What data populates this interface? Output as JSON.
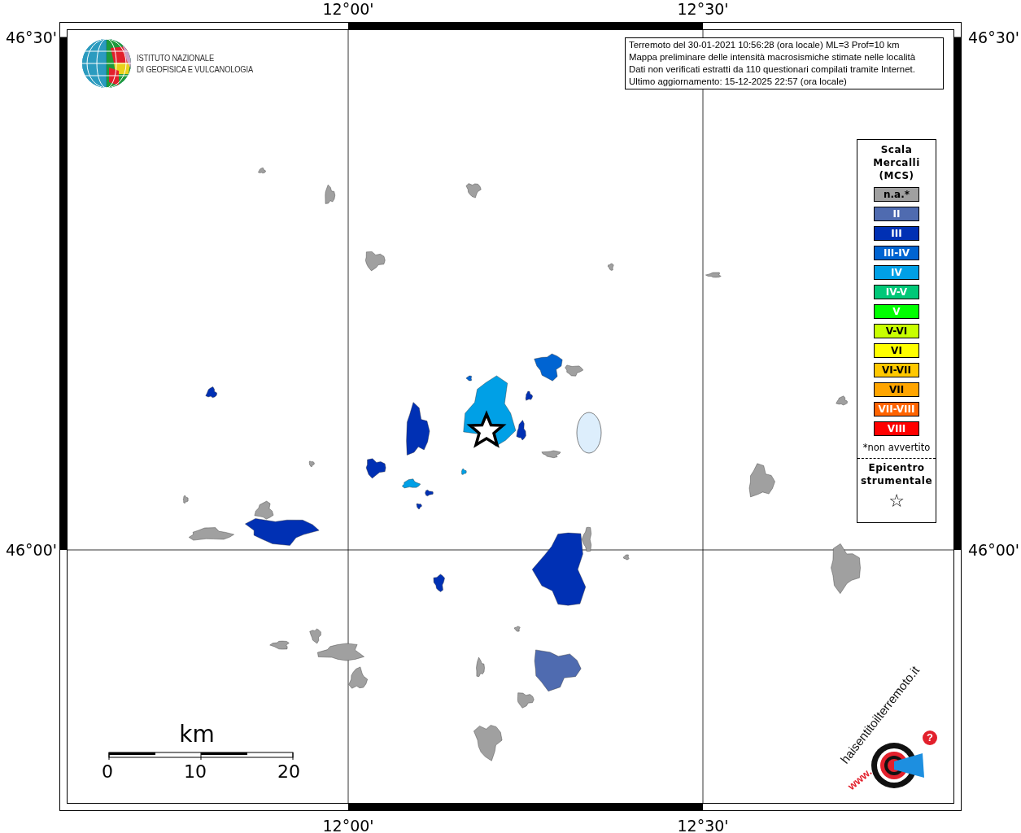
{
  "map": {
    "axis_labels": {
      "top": [
        "12°00'",
        "12°30'"
      ],
      "bottom": [
        "12°00'",
        "12°30'"
      ],
      "left": [
        "46°30'",
        "46°00'"
      ],
      "right": [
        "46°30'",
        "46°00'"
      ]
    },
    "areas": [
      {
        "color": "#a0a0a0"
      },
      {
        "color": "#a0a0a0"
      },
      {
        "color": "#a0a0a0"
      },
      {
        "color": "#a0a0a0"
      },
      {
        "color": "#a0a0a0"
      },
      {
        "color": "#a0a0a0"
      },
      {
        "color": "#a0a0a0"
      },
      {
        "color": "#a0a0a0"
      },
      {
        "color": "#a0a0a0"
      },
      {
        "color": "#a0a0a0"
      },
      {
        "color": "#a0a0a0"
      },
      {
        "color": "#a0a0a0"
      },
      {
        "color": "#a0a0a0"
      },
      {
        "color": "#a0a0a0"
      },
      {
        "color": "#a0a0a0"
      },
      {
        "color": "#a0a0a0"
      },
      {
        "color": "#a0a0a0"
      },
      {
        "color": "#a0a0a0"
      },
      {
        "color": "#a0a0a0"
      },
      {
        "color": "#a0a0a0"
      },
      {
        "color": "#a0a0a0"
      },
      {
        "color": "#a0a0a0"
      },
      {
        "color": "#a0a0a0"
      },
      {
        "color": "#a0a0a0"
      },
      {
        "color": "#a0a0a0"
      },
      {
        "color": "#0030b4"
      },
      {
        "color": "#0030b4"
      },
      {
        "color": "#0030b4"
      },
      {
        "color": "#0030b4"
      },
      {
        "color": "#0030b4"
      },
      {
        "color": "#0030b4"
      },
      {
        "color": "#0030b4"
      },
      {
        "color": "#0030b4"
      },
      {
        "color": "#0030b4"
      },
      {
        "color": "#0030b4"
      },
      {
        "color": "#0064d2"
      },
      {
        "color": "#0064d2"
      },
      {
        "color": "#00a0e6"
      },
      {
        "color": "#00a0e6"
      },
      {
        "color": "#00a0e6"
      },
      {
        "color": "#4f6bb0"
      }
    ]
  },
  "institute": {
    "lines": [
      "ISTITUTO NAZIONALE",
      "DI GEOFISICA E VULCANOLOGIA"
    ]
  },
  "info": [
    "Terremoto del 30-01-2021 10:56:28 (ora locale) ML=3 Prof=10 km",
    "Mappa preliminare delle intensità macrosismiche stimate nelle località",
    "Dati non verificati estratti da 110 questionari compilati tramite Internet.",
    "Ultimo aggiornamento: 15-12-2025 22:57 (ora locale)"
  ],
  "legend": {
    "title": [
      "Scala",
      "Mercalli",
      "(MCS)"
    ],
    "items": [
      {
        "label": "n.a.*",
        "color": "#a0a0a0"
      },
      {
        "label": "II",
        "color": "#4f6bb0"
      },
      {
        "label": "III",
        "color": "#0030b4"
      },
      {
        "label": "III-IV",
        "color": "#0064d2"
      },
      {
        "label": "IV",
        "color": "#00a0e6"
      },
      {
        "label": "IV-V",
        "color": "#00c878"
      },
      {
        "label": "V",
        "color": "#00ff00"
      },
      {
        "label": "V-VI",
        "color": "#c8ff00"
      },
      {
        "label": "VI",
        "color": "#ffff00"
      },
      {
        "label": "VI-VII",
        "color": "#ffc800"
      },
      {
        "label": "VII",
        "color": "#ffa500"
      },
      {
        "label": "VII-VIII",
        "color": "#ff6400"
      },
      {
        "label": "VIII",
        "color": "#ff0000"
      }
    ],
    "note": "*non avvertito",
    "epicenter": [
      "Epicentro",
      "strumentale"
    ],
    "star": "☆"
  },
  "scale_bar": {
    "unit": "km",
    "ticks": [
      "0",
      "10",
      "20"
    ]
  },
  "badge": {
    "ring_text": "haisentitoilterremoto.it",
    "www": "www.",
    "mark": "?"
  }
}
